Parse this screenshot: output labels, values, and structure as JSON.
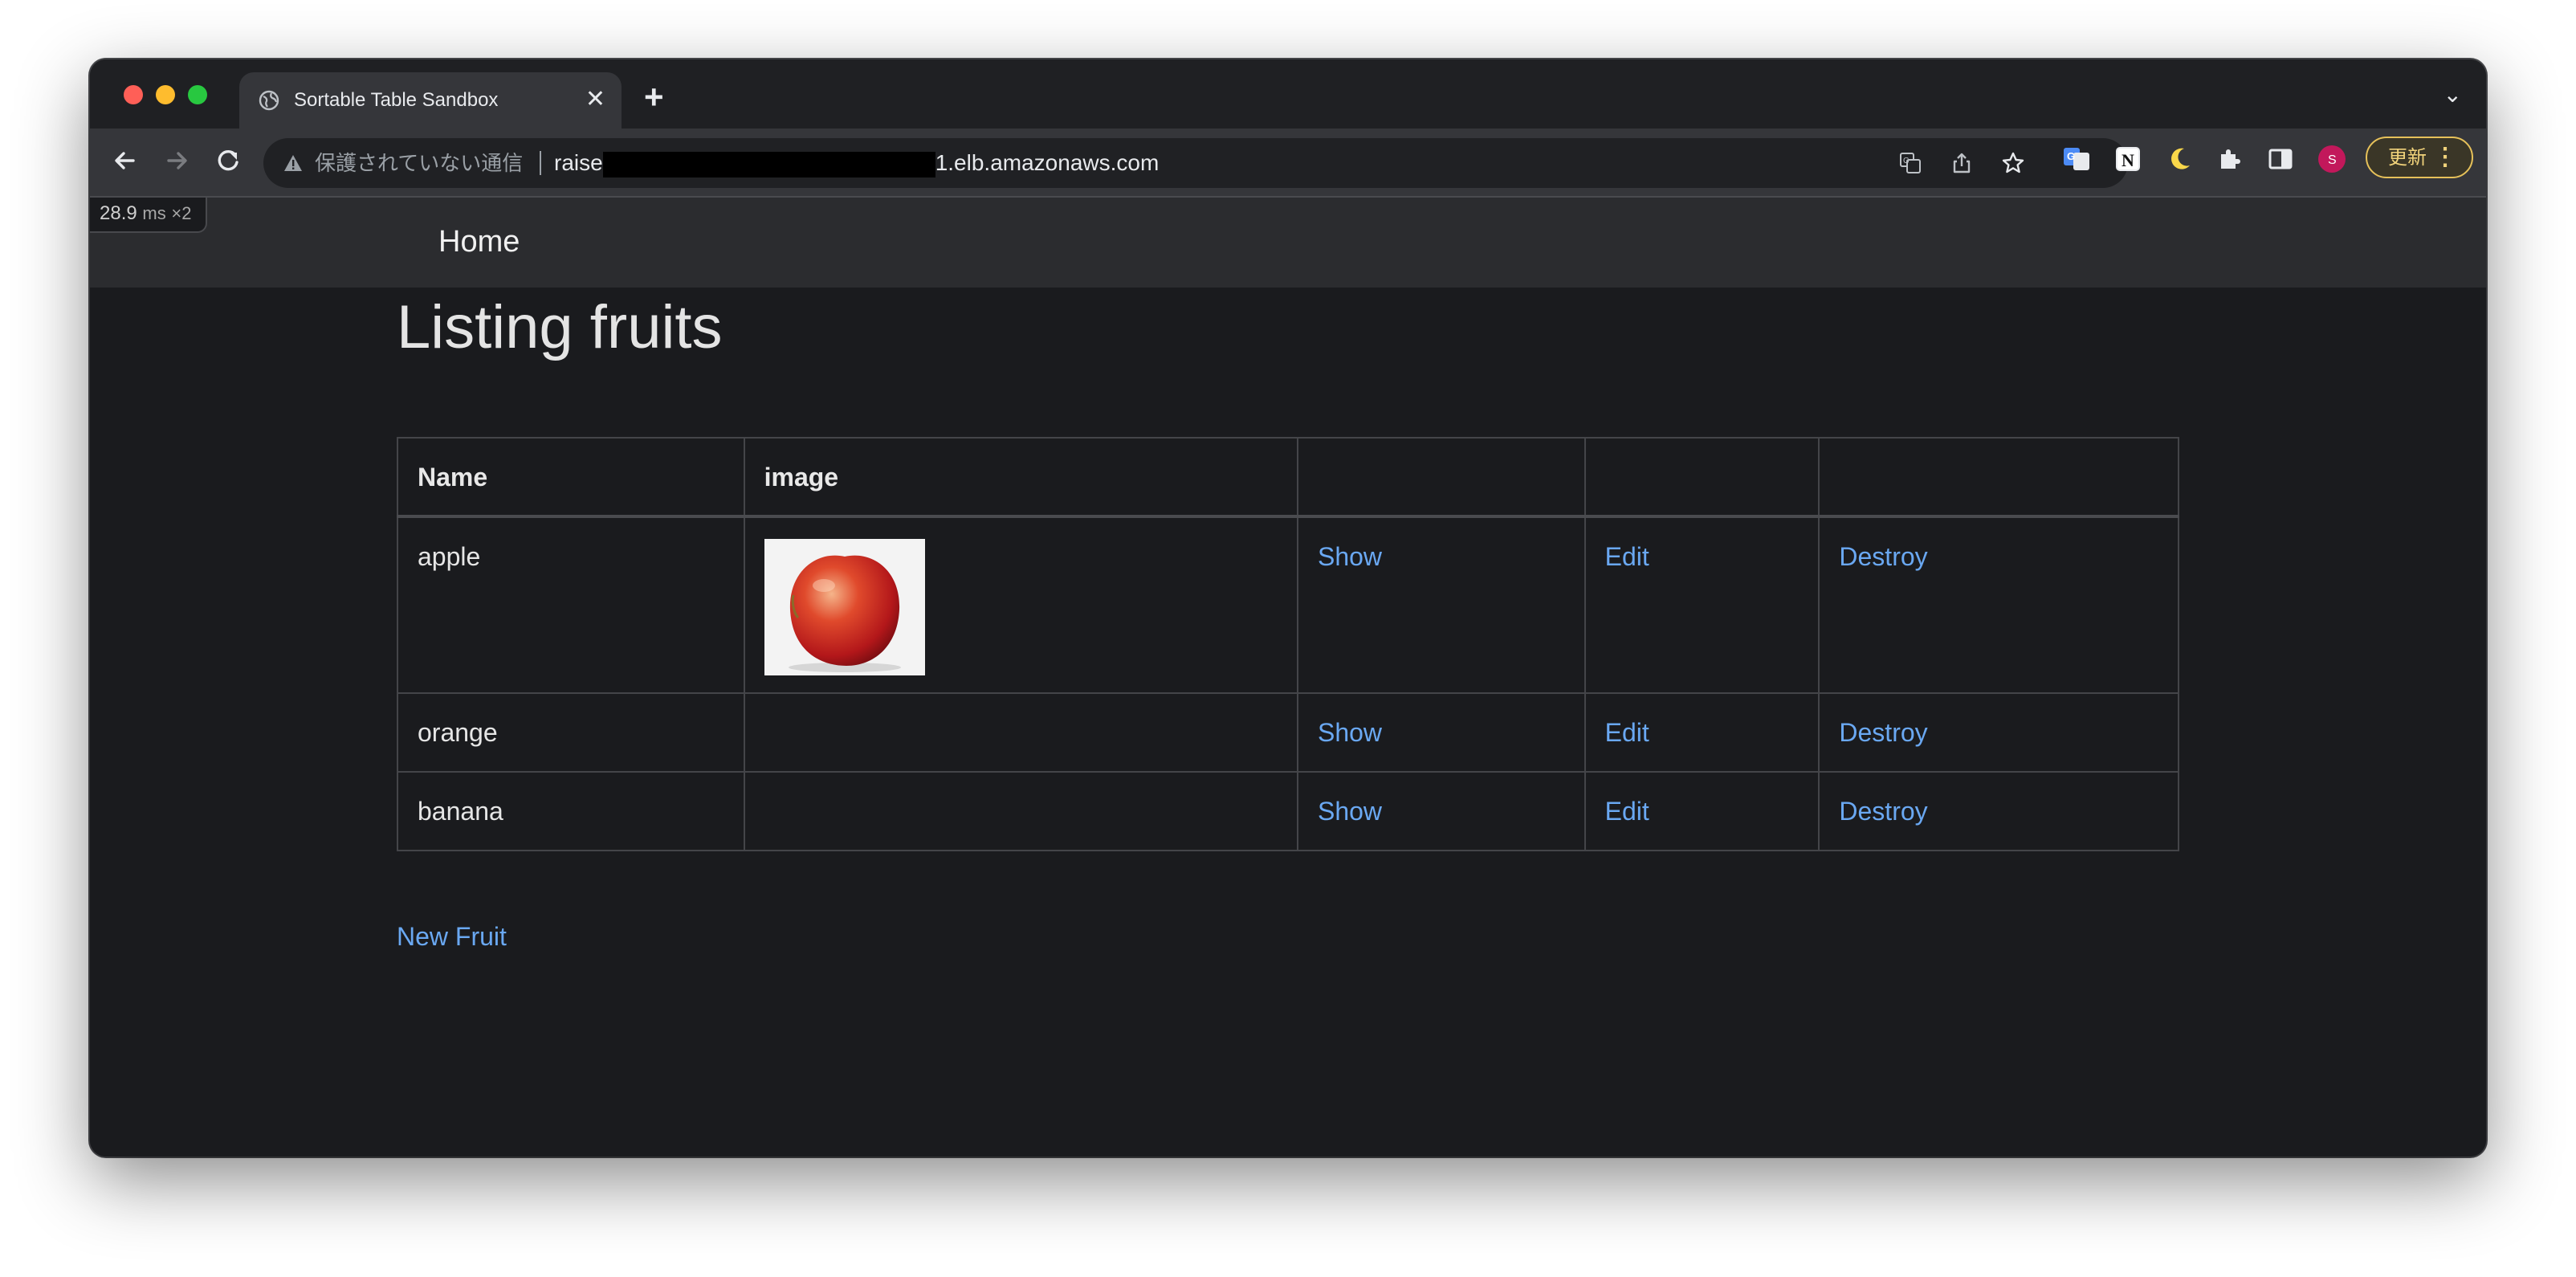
{
  "browser": {
    "tab_title": "Sortable Table Sandbox",
    "tab_close": "✕",
    "new_tab": "+",
    "tab_menu": "⌄",
    "not_secure_label": "保護されていない通信",
    "url_prefix": "raise",
    "url_suffix": "1.elb.amazonaws.com",
    "update_label": "更新",
    "accent_colors": {
      "update_border": "#e6c15a",
      "profile_avatar": "#c2185b"
    },
    "profile_initial": "S",
    "icons": [
      "globe-icon",
      "back-arrow-icon",
      "forward-arrow-icon",
      "reload-icon",
      "warning-icon",
      "translate-icon",
      "share-icon",
      "bookmark-star-icon",
      "google-translate-ext-icon",
      "notion-ext-icon",
      "dark-mode-moon-icon",
      "extensions-puzzle-icon",
      "side-panel-icon",
      "avatar",
      "more-menu-icon"
    ]
  },
  "perf_badge": {
    "value": "28.9",
    "unit": "ms",
    "multiplier": "×2"
  },
  "navbar": {
    "home_label": "Home"
  },
  "page": {
    "title": "Listing fruits",
    "table": {
      "headers": [
        "Name",
        "image",
        "",
        "",
        ""
      ],
      "rows": [
        {
          "name": "apple",
          "has_image": true,
          "image_alt": "red-apple-photo",
          "show": "Show",
          "edit": "Edit",
          "destroy": "Destroy"
        },
        {
          "name": "orange",
          "has_image": false,
          "show": "Show",
          "edit": "Edit",
          "destroy": "Destroy"
        },
        {
          "name": "banana",
          "has_image": false,
          "show": "Show",
          "edit": "Edit",
          "destroy": "Destroy"
        }
      ]
    },
    "new_link": "New Fruit",
    "link_color": "#6aa8f2"
  }
}
